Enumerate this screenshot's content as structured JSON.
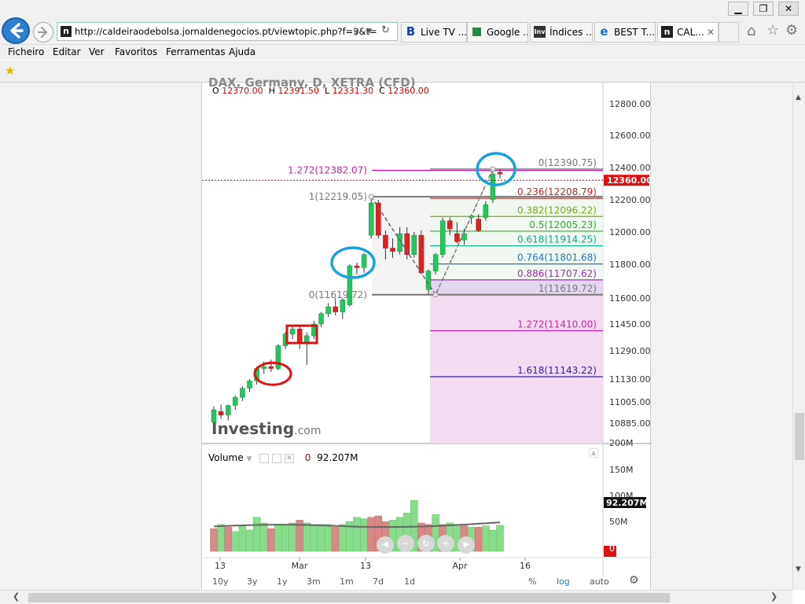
{
  "browser": {
    "url": "http://caldeiraodebolsa.jornaldenegocios.pt/viewtopic.php?f=3&t=",
    "tabs": [
      {
        "label": "Live TV ...",
        "icon": "B"
      },
      {
        "label": "Google ...",
        "icon": ""
      },
      {
        "label": "Índices ...",
        "icon": "Inv"
      },
      {
        "label": "BEST T...",
        "icon": "e"
      },
      {
        "label": "CAL...",
        "icon": "n"
      }
    ],
    "menu": [
      "Ficheiro",
      "Editar",
      "Ver",
      "Favoritos",
      "Ferramentas",
      "Ajuda"
    ]
  },
  "chart_header": {
    "title": "DAX, Germany, D, XETRA (CFD)",
    "o_label": "O",
    "o_value": "12370.00",
    "h_label": "H",
    "h_value": "12391.50",
    "l_label": "L",
    "l_value": "12331.30",
    "c_label": "C",
    "c_value": "12360.00"
  },
  "chart_data": {
    "type": "candlestick",
    "price_axis_labels": [
      "12800.00",
      "12600.00",
      "12400.00",
      "12200.00",
      "12000.00",
      "11800.00",
      "11600.00",
      "11450.00",
      "11290.00",
      "11130.00",
      "11005.00",
      "10885.00"
    ],
    "last_price_label": "12360.00",
    "fibonacci_right": [
      {
        "label": "0(12390.75)",
        "color": "#777777"
      },
      {
        "label": "0.236(12208.79)",
        "color": "#cc2222"
      },
      {
        "label": "0.382(12096.22)",
        "color": "#77aa11"
      },
      {
        "label": "0.5(12005.23)",
        "color": "#33aa33"
      },
      {
        "label": "0.618(11914.25)",
        "color": "#11aa88"
      },
      {
        "label": "0.764(11801.68)",
        "color": "#2277bb"
      },
      {
        "label": "0.886(11707.62)",
        "color": "#9933aa"
      },
      {
        "label": "1(11619.72)",
        "color": "#777777"
      },
      {
        "label": "1.272(11410.00)",
        "color": "#cc22aa"
      },
      {
        "label": "1.618(11143.22)",
        "color": "#332299"
      }
    ],
    "fibonacci_left": [
      {
        "label": "1.272(12382.07)",
        "color": "#cc22aa"
      },
      {
        "label": "1(12219.05)",
        "color": "#777777"
      },
      {
        "label": "0(11619.72)",
        "color": "#777777"
      }
    ],
    "candles": [
      {
        "o": 10890,
        "h": 10980,
        "l": 10860,
        "c": 10960
      },
      {
        "o": 10950,
        "h": 10990,
        "l": 10910,
        "c": 10930
      },
      {
        "o": 10930,
        "h": 10990,
        "l": 10900,
        "c": 10985
      },
      {
        "o": 10985,
        "h": 11040,
        "l": 10960,
        "c": 11030
      },
      {
        "o": 11030,
        "h": 11090,
        "l": 11010,
        "c": 11080
      },
      {
        "o": 11080,
        "h": 11130,
        "l": 11060,
        "c": 11120
      },
      {
        "o": 11120,
        "h": 11200,
        "l": 11100,
        "c": 11190
      },
      {
        "o": 11190,
        "h": 11230,
        "l": 11160,
        "c": 11200
      },
      {
        "o": 11200,
        "h": 11240,
        "l": 11170,
        "c": 11190
      },
      {
        "o": 11190,
        "h": 11330,
        "l": 11180,
        "c": 11320
      },
      {
        "o": 11320,
        "h": 11400,
        "l": 11300,
        "c": 11390
      },
      {
        "o": 11390,
        "h": 11440,
        "l": 11360,
        "c": 11420
      },
      {
        "o": 11420,
        "h": 11440,
        "l": 11300,
        "c": 11340
      },
      {
        "o": 11340,
        "h": 11400,
        "l": 11210,
        "c": 11380
      },
      {
        "o": 11380,
        "h": 11470,
        "l": 11360,
        "c": 11450
      },
      {
        "o": 11450,
        "h": 11520,
        "l": 11430,
        "c": 11510
      },
      {
        "o": 11510,
        "h": 11570,
        "l": 11490,
        "c": 11550
      },
      {
        "o": 11550,
        "h": 11600,
        "l": 11500,
        "c": 11520
      },
      {
        "o": 11520,
        "h": 11600,
        "l": 11480,
        "c": 11590
      },
      {
        "o": 11560,
        "h": 11800,
        "l": 11550,
        "c": 11790
      },
      {
        "o": 11790,
        "h": 11810,
        "l": 11740,
        "c": 11780
      },
      {
        "o": 11780,
        "h": 11870,
        "l": 11750,
        "c": 11860
      },
      {
        "o": 11980,
        "h": 12219,
        "l": 11960,
        "c": 12180
      },
      {
        "o": 12180,
        "h": 12200,
        "l": 11960,
        "c": 11980
      },
      {
        "o": 11980,
        "h": 12010,
        "l": 11830,
        "c": 11900
      },
      {
        "o": 11900,
        "h": 11960,
        "l": 11840,
        "c": 11880
      },
      {
        "o": 11880,
        "h": 12030,
        "l": 11860,
        "c": 11990
      },
      {
        "o": 11990,
        "h": 12030,
        "l": 11830,
        "c": 11860
      },
      {
        "o": 11860,
        "h": 12000,
        "l": 11840,
        "c": 11980
      },
      {
        "o": 11980,
        "h": 12010,
        "l": 11740,
        "c": 11750
      },
      {
        "o": 11650,
        "h": 11770,
        "l": 11620,
        "c": 11760
      },
      {
        "o": 11760,
        "h": 11870,
        "l": 11740,
        "c": 11860
      },
      {
        "o": 11860,
        "h": 12090,
        "l": 11840,
        "c": 12070
      },
      {
        "o": 12070,
        "h": 12090,
        "l": 11980,
        "c": 12020
      },
      {
        "o": 11990,
        "h": 12060,
        "l": 11930,
        "c": 11940
      },
      {
        "o": 11950,
        "h": 12020,
        "l": 11920,
        "c": 11990
      },
      {
        "o": 12090,
        "h": 12110,
        "l": 12050,
        "c": 12100
      },
      {
        "o": 12080,
        "h": 12110,
        "l": 12000,
        "c": 12010
      },
      {
        "o": 12090,
        "h": 12190,
        "l": 12070,
        "c": 12170
      },
      {
        "o": 12200,
        "h": 12391,
        "l": 12180,
        "c": 12360
      },
      {
        "o": 12370,
        "h": 12391,
        "l": 12331,
        "c": 12360
      }
    ],
    "volume_label": "Volume",
    "volume_value": "92.207M",
    "volume_zero": "0",
    "volume_axis": [
      "200M",
      "150M",
      "100M",
      "50M",
      "0"
    ],
    "volumes": [
      {
        "v": 80,
        "up": false
      },
      {
        "v": 95,
        "up": true
      },
      {
        "v": 85,
        "up": false
      },
      {
        "v": 70,
        "up": true
      },
      {
        "v": 90,
        "up": true
      },
      {
        "v": 75,
        "up": true
      },
      {
        "v": 120,
        "up": true
      },
      {
        "v": 100,
        "up": true
      },
      {
        "v": 80,
        "up": false
      },
      {
        "v": 95,
        "up": true
      },
      {
        "v": 95,
        "up": true
      },
      {
        "v": 100,
        "up": true
      },
      {
        "v": 110,
        "up": false
      },
      {
        "v": 100,
        "up": true
      },
      {
        "v": 95,
        "up": true
      },
      {
        "v": 95,
        "up": true
      },
      {
        "v": 95,
        "up": true
      },
      {
        "v": 85,
        "up": false
      },
      {
        "v": 95,
        "up": true
      },
      {
        "v": 105,
        "up": true
      },
      {
        "v": 120,
        "up": true
      },
      {
        "v": 115,
        "up": true
      },
      {
        "v": 120,
        "up": false
      },
      {
        "v": 125,
        "up": false
      },
      {
        "v": 105,
        "up": false
      },
      {
        "v": 110,
        "up": true
      },
      {
        "v": 120,
        "up": true
      },
      {
        "v": 135,
        "up": true
      },
      {
        "v": 180,
        "up": true
      },
      {
        "v": 100,
        "up": false
      },
      {
        "v": 95,
        "up": false
      },
      {
        "v": 130,
        "up": true
      },
      {
        "v": 95,
        "up": false
      },
      {
        "v": 100,
        "up": true
      },
      {
        "v": 95,
        "up": true
      },
      {
        "v": 90,
        "up": false
      },
      {
        "v": 85,
        "up": true
      },
      {
        "v": 85,
        "up": false
      },
      {
        "v": 90,
        "up": true
      },
      {
        "v": 75,
        "up": true
      },
      {
        "v": 92,
        "up": true
      }
    ],
    "x_labels": [
      "13",
      "Mar",
      "13",
      "Apr",
      "16"
    ],
    "watermark_main": "Investing",
    "watermark_suffix": ".com"
  },
  "timeframes": [
    "10y",
    "3y",
    "1y",
    "3m",
    "1m",
    "7d",
    "1d"
  ],
  "bottom_right": {
    "percent": "%",
    "log": "log",
    "auto": "auto"
  }
}
